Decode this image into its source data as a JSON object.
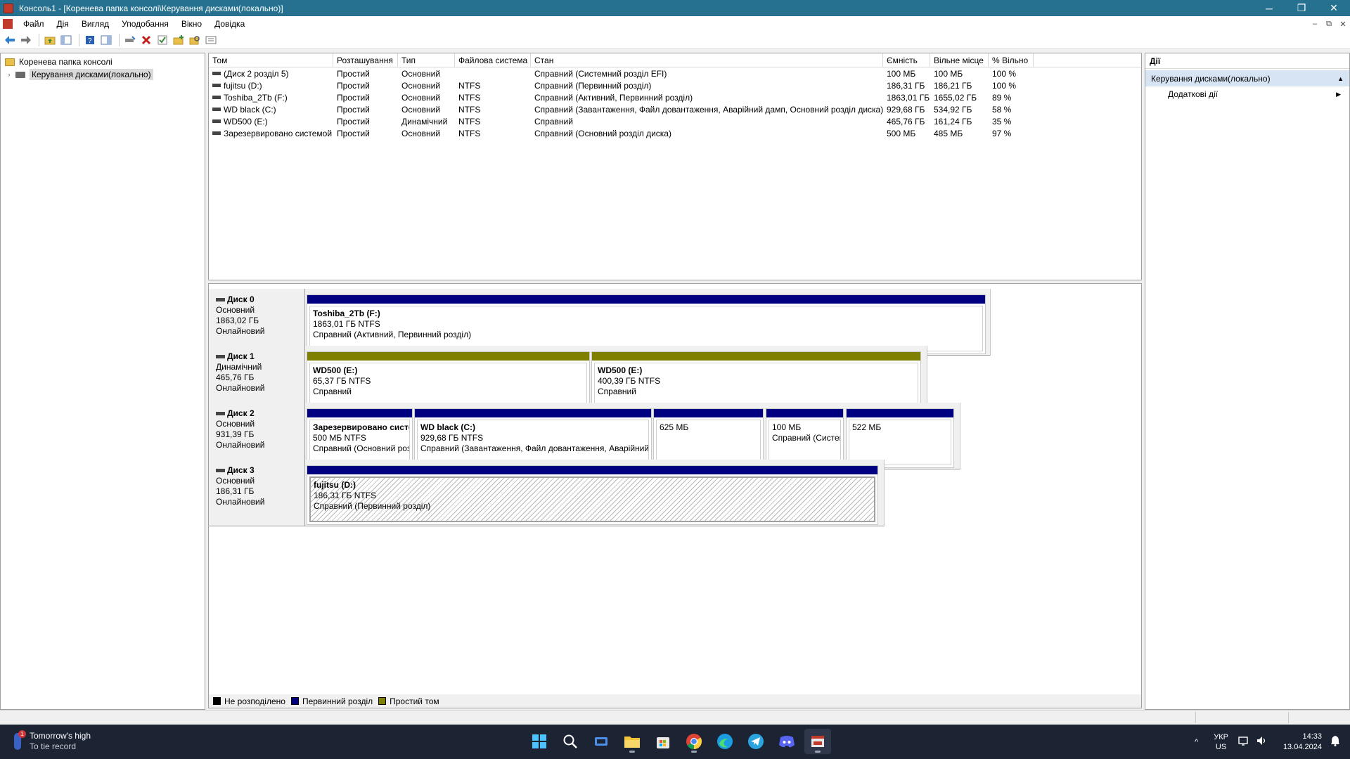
{
  "window": {
    "title": "Консоль1 - [Коренева папка консолі\\Керування дисками(локально)]",
    "minimize_glyph": "─",
    "restore_glyph": "❐",
    "close_glyph": "✕"
  },
  "menu": {
    "items": [
      "Файл",
      "Дія",
      "Вигляд",
      "Уподобання",
      "Вікно",
      "Довідка"
    ],
    "child_minimize": "–",
    "child_restore": "⧉",
    "child_close": "✕"
  },
  "toolbar": {
    "icons": [
      "back-arrow-icon",
      "forward-arrow-icon",
      "up-folder-icon",
      "show-hide-tree-icon",
      "help-icon",
      "properties-pane-icon",
      "connect-drive-icon",
      "delete-icon",
      "check-icon",
      "new-folder-icon",
      "search-icon",
      "settings-list-icon"
    ]
  },
  "tree": {
    "root": "Коренева папка консолі",
    "child": "Керування дисками(локально)"
  },
  "volume_list": {
    "columns": [
      "Том",
      "Розташування",
      "Тип",
      "Файлова система",
      "Стан",
      "Ємність",
      "Вільне місце",
      "% Вільно"
    ],
    "rows": [
      {
        "vol": "(Диск 2 розділ 5)",
        "loc": "Простий",
        "type": "Основний",
        "fs": "",
        "status": "Справний (Системний розділ EFI)",
        "cap": "100 МБ",
        "free": "100 МБ",
        "pct": "100 %"
      },
      {
        "vol": "fujitsu (D:)",
        "loc": "Простий",
        "type": "Основний",
        "fs": "NTFS",
        "status": "Справний (Первинний розділ)",
        "cap": "186,31 ГБ",
        "free": "186,21 ГБ",
        "pct": "100 %"
      },
      {
        "vol": "Toshiba_2Tb (F:)",
        "loc": "Простий",
        "type": "Основний",
        "fs": "NTFS",
        "status": "Справний (Активний, Первинний розділ)",
        "cap": "1863,01 ГБ",
        "free": "1655,02 ГБ",
        "pct": "89 %"
      },
      {
        "vol": "WD black (C:)",
        "loc": "Простий",
        "type": "Основний",
        "fs": "NTFS",
        "status": "Справний (Завантаження, Файл довантаження, Аварійний дамп, Основний розділ диска)",
        "cap": "929,68 ГБ",
        "free": "534,92 ГБ",
        "pct": "58 %"
      },
      {
        "vol": "WD500 (E:)",
        "loc": "Простий",
        "type": "Динамічний",
        "fs": "NTFS",
        "status": "Справний",
        "cap": "465,76 ГБ",
        "free": "161,24 ГБ",
        "pct": "35 %"
      },
      {
        "vol": "Зарезервировано системой",
        "loc": "Простий",
        "type": "Основний",
        "fs": "NTFS",
        "status": "Справний (Основний розділ диска)",
        "cap": "500 МБ",
        "free": "485 МБ",
        "pct": "97 %"
      }
    ]
  },
  "disks": [
    {
      "name": "Диск 0",
      "kind": "Основний",
      "size": "1863,02 ГБ",
      "state": "Онлайновий",
      "partitions": [
        {
          "title": "Toshiba_2Tb  (F:)",
          "size": "1863,01 ГБ NTFS",
          "status": "Справний (Активний, Первинний розділ)",
          "bar": "primary"
        }
      ]
    },
    {
      "name": "Диск 1",
      "kind": "Динамічний",
      "size": "465,76 ГБ",
      "state": "Онлайновий",
      "partitions": [
        {
          "title": "WD500  (E:)",
          "size": "65,37 ГБ NTFS",
          "status": "Справний",
          "bar": "simple"
        },
        {
          "title": "WD500  (E:)",
          "size": "400,39 ГБ NTFS",
          "status": "Справний",
          "bar": "simple"
        }
      ]
    },
    {
      "name": "Диск 2",
      "kind": "Основний",
      "size": "931,39 ГБ",
      "state": "Онлайновий",
      "partitions": [
        {
          "title": "Зарезервировано системой",
          "size": "500 МБ NTFS",
          "status": "Справний (Основний розділ ди",
          "bar": "primary"
        },
        {
          "title": "WD black  (C:)",
          "size": "929,68 ГБ NTFS",
          "status": "Справний (Завантаження, Файл довантаження, Аварійний дамп, Основни",
          "bar": "primary"
        },
        {
          "title": "",
          "size": "625 МБ",
          "status": "",
          "bar": "primary"
        },
        {
          "title": "",
          "size": "100 МБ",
          "status": "Справний (Системний",
          "bar": "primary"
        },
        {
          "title": "",
          "size": "522 МБ",
          "status": "",
          "bar": "primary"
        }
      ]
    },
    {
      "name": "Диск 3",
      "kind": "Основний",
      "size": "186,31 ГБ",
      "state": "Онлайновий",
      "partitions": [
        {
          "title": "fujitsu  (D:)",
          "size": "186,31 ГБ NTFS",
          "status": "Справний (Первинний розділ)",
          "bar": "primary"
        }
      ]
    }
  ],
  "legend": {
    "items": [
      {
        "label": "Не розподілено",
        "color": "#000000"
      },
      {
        "label": "Первинний розділ",
        "color": "#000080"
      },
      {
        "label": "Простий том",
        "color": "#808000"
      }
    ]
  },
  "actions": {
    "title": "Дії",
    "section": "Керування дисками(локально)",
    "item": "Додаткові дії"
  },
  "taskbar": {
    "weather_title": "Tomorrow's high",
    "weather_sub": "To tie record",
    "weather_badge": "1",
    "apps": [
      "start-icon",
      "search-icon",
      "task-view-icon",
      "file-explorer-icon",
      "microsoft-store-icon",
      "chrome-icon",
      "edge-icon",
      "telegram-icon",
      "discord-icon",
      "disk-management-icon"
    ],
    "lang_top": "УКР",
    "lang_bottom": "US",
    "time": "14:33",
    "date": "13.04.2024",
    "tray_chevron": "^"
  },
  "colors": {
    "title_bar": "#26718f",
    "primary_partition": "#000080",
    "simple_volume": "#808000",
    "taskbar": "#1c2434"
  }
}
